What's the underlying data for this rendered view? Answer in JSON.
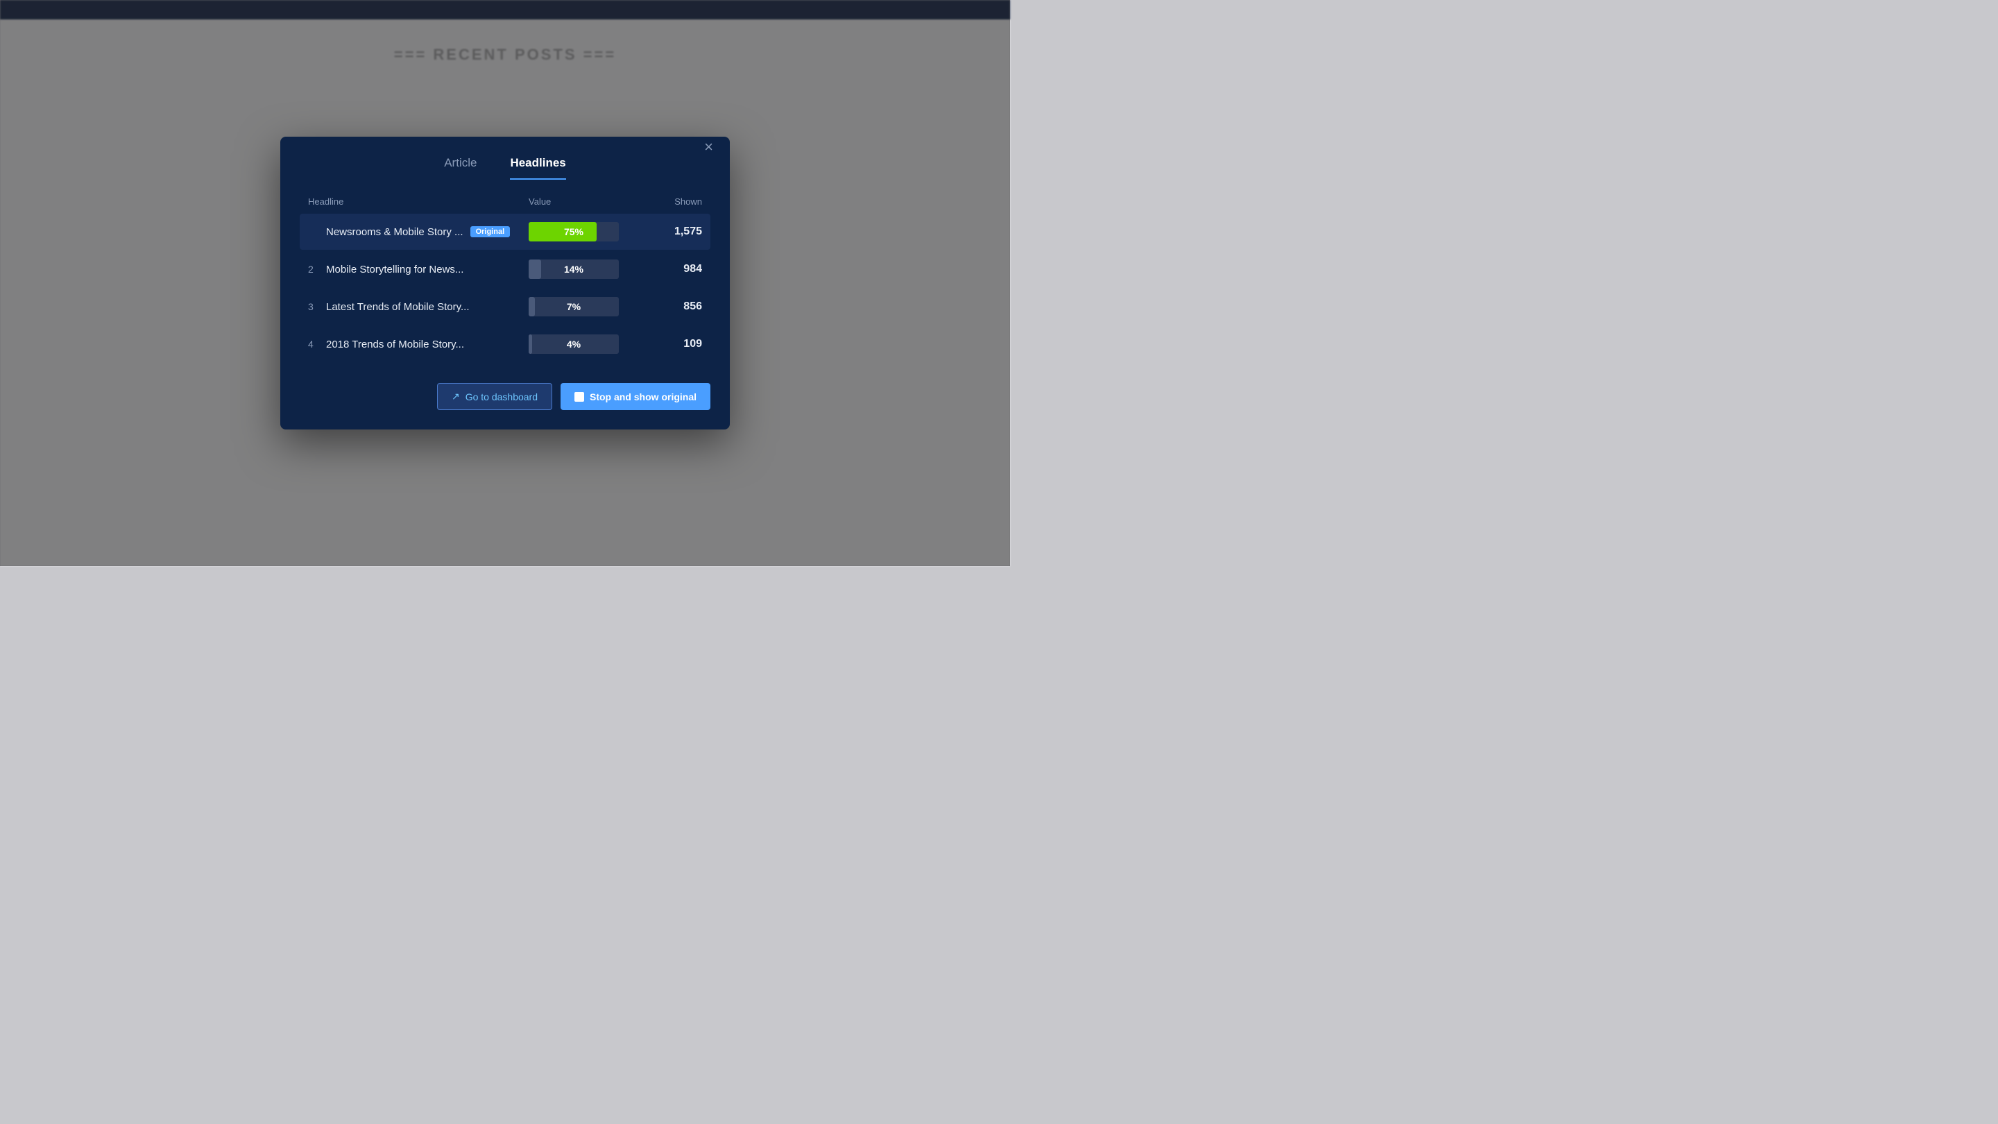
{
  "background": {
    "recent_posts_label": "=== RECENT POSTS ==="
  },
  "modal": {
    "tabs": [
      {
        "id": "article",
        "label": "Article",
        "active": false
      },
      {
        "id": "headlines",
        "label": "Headlines",
        "active": true
      }
    ],
    "close_label": "×",
    "table": {
      "columns": {
        "headline": "Headline",
        "value": "Value",
        "shown": "Shown"
      },
      "rows": [
        {
          "num": "",
          "title": "Newsrooms & Mobile Story ...",
          "badge": "Original",
          "value_pct": "75%",
          "value_fill": 75,
          "value_type": "green",
          "shown": "1,575",
          "highlighted": true
        },
        {
          "num": "2",
          "title": "Mobile Storytelling for News...",
          "badge": null,
          "value_pct": "14%",
          "value_fill": 14,
          "value_type": "gray",
          "shown": "984",
          "highlighted": false
        },
        {
          "num": "3",
          "title": "Latest Trends of Mobile Story...",
          "badge": null,
          "value_pct": "7%",
          "value_fill": 7,
          "value_type": "gray",
          "shown": "856",
          "highlighted": false
        },
        {
          "num": "4",
          "title": "2018 Trends of Mobile Story...",
          "badge": null,
          "value_pct": "4%",
          "value_fill": 4,
          "value_type": "gray",
          "shown": "109",
          "highlighted": false
        }
      ]
    },
    "footer": {
      "dashboard_btn": "Go to dashboard",
      "stop_btn": "Stop and show original",
      "dashboard_icon": "↗",
      "stop_icon": "■"
    }
  }
}
